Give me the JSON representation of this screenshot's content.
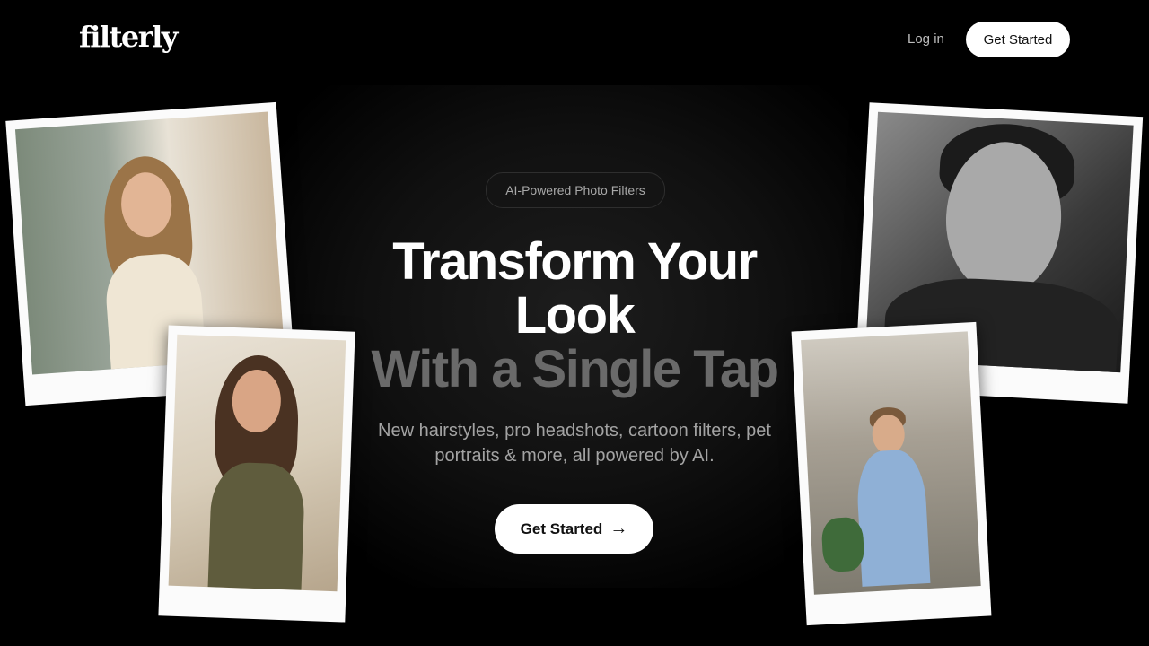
{
  "nav": {
    "logo": "filterly",
    "login_label": "Log in",
    "cta_label": "Get Started"
  },
  "hero": {
    "badge": "AI-Powered Photo Filters",
    "title_line1": "Transform Your",
    "title_line2": "Look",
    "title_line3": "With a Single Tap",
    "subtitle": "New hairstyles, pro headshots, cartoon filters, pet portraits & more, all powered by AI.",
    "cta_label": "Get Started",
    "cta_arrow": "→"
  },
  "colors": {
    "background": "#000000",
    "title_primary": "#ffffff",
    "title_muted": "#6a6a6a",
    "subtitle": "#a3a3a3",
    "button_bg": "#ffffff",
    "button_text": "#111111"
  }
}
